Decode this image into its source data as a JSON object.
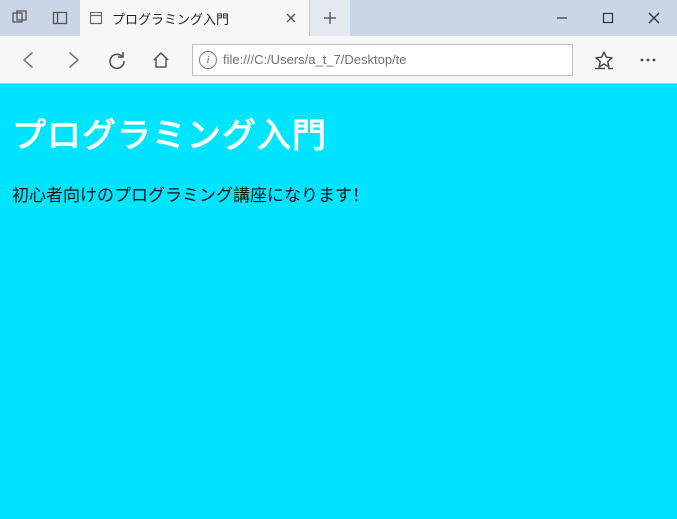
{
  "tab": {
    "title": "プログラミング入門"
  },
  "addressbar": {
    "url": "file:///C:/Users/a_t_7/Desktop/te"
  },
  "page": {
    "heading": "プログラミング入門",
    "paragraph": "初心者向けのプログラミング講座になります！"
  }
}
